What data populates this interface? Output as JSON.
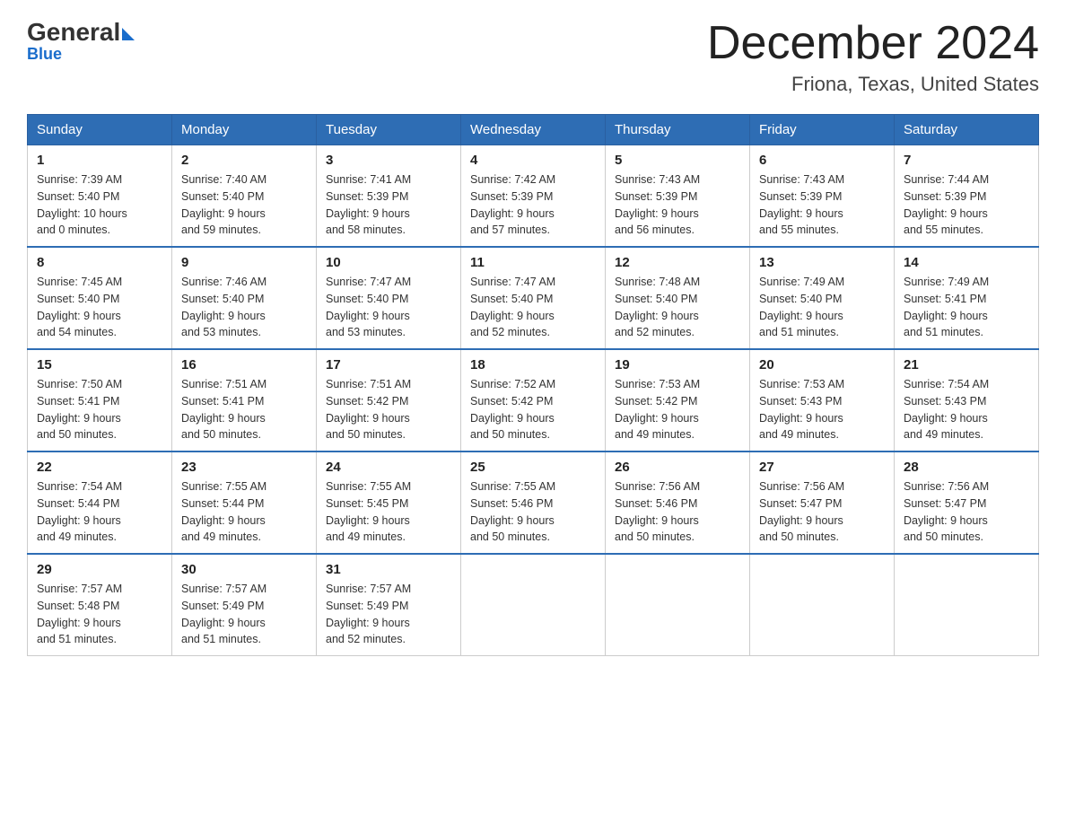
{
  "logo": {
    "general": "General",
    "blue": "Blue"
  },
  "title": "December 2024",
  "subtitle": "Friona, Texas, United States",
  "days_of_week": [
    "Sunday",
    "Monday",
    "Tuesday",
    "Wednesday",
    "Thursday",
    "Friday",
    "Saturday"
  ],
  "weeks": [
    [
      {
        "day": "1",
        "sunrise": "7:39 AM",
        "sunset": "5:40 PM",
        "daylight": "10 hours and 0 minutes."
      },
      {
        "day": "2",
        "sunrise": "7:40 AM",
        "sunset": "5:40 PM",
        "daylight": "9 hours and 59 minutes."
      },
      {
        "day": "3",
        "sunrise": "7:41 AM",
        "sunset": "5:39 PM",
        "daylight": "9 hours and 58 minutes."
      },
      {
        "day": "4",
        "sunrise": "7:42 AM",
        "sunset": "5:39 PM",
        "daylight": "9 hours and 57 minutes."
      },
      {
        "day": "5",
        "sunrise": "7:43 AM",
        "sunset": "5:39 PM",
        "daylight": "9 hours and 56 minutes."
      },
      {
        "day": "6",
        "sunrise": "7:43 AM",
        "sunset": "5:39 PM",
        "daylight": "9 hours and 55 minutes."
      },
      {
        "day": "7",
        "sunrise": "7:44 AM",
        "sunset": "5:39 PM",
        "daylight": "9 hours and 55 minutes."
      }
    ],
    [
      {
        "day": "8",
        "sunrise": "7:45 AM",
        "sunset": "5:40 PM",
        "daylight": "9 hours and 54 minutes."
      },
      {
        "day": "9",
        "sunrise": "7:46 AM",
        "sunset": "5:40 PM",
        "daylight": "9 hours and 53 minutes."
      },
      {
        "day": "10",
        "sunrise": "7:47 AM",
        "sunset": "5:40 PM",
        "daylight": "9 hours and 53 minutes."
      },
      {
        "day": "11",
        "sunrise": "7:47 AM",
        "sunset": "5:40 PM",
        "daylight": "9 hours and 52 minutes."
      },
      {
        "day": "12",
        "sunrise": "7:48 AM",
        "sunset": "5:40 PM",
        "daylight": "9 hours and 52 minutes."
      },
      {
        "day": "13",
        "sunrise": "7:49 AM",
        "sunset": "5:40 PM",
        "daylight": "9 hours and 51 minutes."
      },
      {
        "day": "14",
        "sunrise": "7:49 AM",
        "sunset": "5:41 PM",
        "daylight": "9 hours and 51 minutes."
      }
    ],
    [
      {
        "day": "15",
        "sunrise": "7:50 AM",
        "sunset": "5:41 PM",
        "daylight": "9 hours and 50 minutes."
      },
      {
        "day": "16",
        "sunrise": "7:51 AM",
        "sunset": "5:41 PM",
        "daylight": "9 hours and 50 minutes."
      },
      {
        "day": "17",
        "sunrise": "7:51 AM",
        "sunset": "5:42 PM",
        "daylight": "9 hours and 50 minutes."
      },
      {
        "day": "18",
        "sunrise": "7:52 AM",
        "sunset": "5:42 PM",
        "daylight": "9 hours and 50 minutes."
      },
      {
        "day": "19",
        "sunrise": "7:53 AM",
        "sunset": "5:42 PM",
        "daylight": "9 hours and 49 minutes."
      },
      {
        "day": "20",
        "sunrise": "7:53 AM",
        "sunset": "5:43 PM",
        "daylight": "9 hours and 49 minutes."
      },
      {
        "day": "21",
        "sunrise": "7:54 AM",
        "sunset": "5:43 PM",
        "daylight": "9 hours and 49 minutes."
      }
    ],
    [
      {
        "day": "22",
        "sunrise": "7:54 AM",
        "sunset": "5:44 PM",
        "daylight": "9 hours and 49 minutes."
      },
      {
        "day": "23",
        "sunrise": "7:55 AM",
        "sunset": "5:44 PM",
        "daylight": "9 hours and 49 minutes."
      },
      {
        "day": "24",
        "sunrise": "7:55 AM",
        "sunset": "5:45 PM",
        "daylight": "9 hours and 49 minutes."
      },
      {
        "day": "25",
        "sunrise": "7:55 AM",
        "sunset": "5:46 PM",
        "daylight": "9 hours and 50 minutes."
      },
      {
        "day": "26",
        "sunrise": "7:56 AM",
        "sunset": "5:46 PM",
        "daylight": "9 hours and 50 minutes."
      },
      {
        "day": "27",
        "sunrise": "7:56 AM",
        "sunset": "5:47 PM",
        "daylight": "9 hours and 50 minutes."
      },
      {
        "day": "28",
        "sunrise": "7:56 AM",
        "sunset": "5:47 PM",
        "daylight": "9 hours and 50 minutes."
      }
    ],
    [
      {
        "day": "29",
        "sunrise": "7:57 AM",
        "sunset": "5:48 PM",
        "daylight": "9 hours and 51 minutes."
      },
      {
        "day": "30",
        "sunrise": "7:57 AM",
        "sunset": "5:49 PM",
        "daylight": "9 hours and 51 minutes."
      },
      {
        "day": "31",
        "sunrise": "7:57 AM",
        "sunset": "5:49 PM",
        "daylight": "9 hours and 52 minutes."
      },
      null,
      null,
      null,
      null
    ]
  ],
  "labels": {
    "sunrise": "Sunrise:",
    "sunset": "Sunset:",
    "daylight": "Daylight:"
  }
}
